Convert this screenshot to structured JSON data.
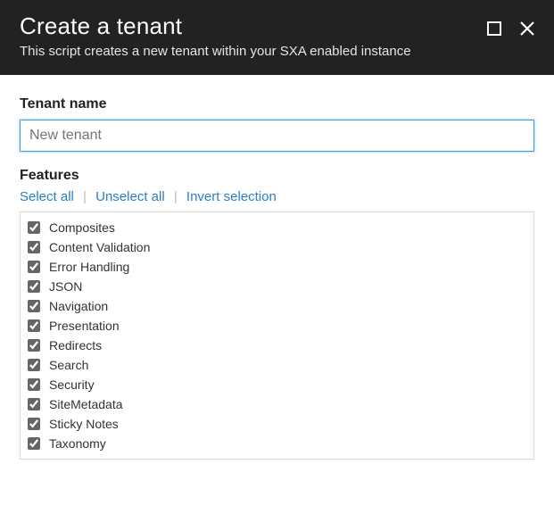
{
  "header": {
    "title": "Create a tenant",
    "subtitle": "This script creates a new tenant within your SXA enabled instance"
  },
  "form": {
    "tenant_label": "Tenant name",
    "tenant_placeholder": "New tenant",
    "tenant_value": "",
    "features_label": "Features",
    "actions": {
      "select_all": "Select all",
      "unselect_all": "Unselect all",
      "invert": "Invert selection"
    },
    "features": [
      {
        "label": "Composites",
        "checked": true
      },
      {
        "label": "Content Validation",
        "checked": true
      },
      {
        "label": "Error Handling",
        "checked": true
      },
      {
        "label": "JSON",
        "checked": true
      },
      {
        "label": "Navigation",
        "checked": true
      },
      {
        "label": "Presentation",
        "checked": true
      },
      {
        "label": "Redirects",
        "checked": true
      },
      {
        "label": "Search",
        "checked": true
      },
      {
        "label": "Security",
        "checked": true
      },
      {
        "label": "SiteMetadata",
        "checked": true
      },
      {
        "label": "Sticky Notes",
        "checked": true
      },
      {
        "label": "Taxonomy",
        "checked": true
      }
    ]
  }
}
